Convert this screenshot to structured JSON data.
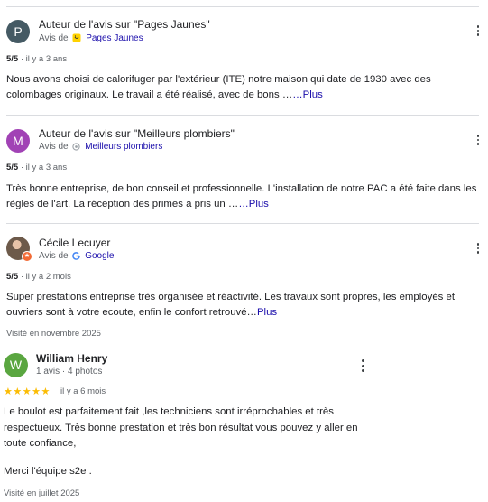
{
  "reviews": [
    {
      "avatar_letter": "P",
      "avatar_color": "#455a64",
      "author": "Auteur de l'avis sur \"Pages Jaunes\"",
      "via": "Avis de",
      "source_name": "Pages Jaunes",
      "source_icon": "pages-jaunes-icon",
      "rating": "5/5",
      "time": " · il y a 3 ans",
      "text": "Nous avons choisi de calorifuger par l'extérieur (ITE) notre maison qui date de 1930 avec des colombages originaux. Le travail a été réalisé, avec de bons …",
      "more": "…Plus"
    },
    {
      "avatar_letter": "M",
      "avatar_color": "#a142b5",
      "author": "Auteur de l'avis sur \"Meilleurs plombiers\"",
      "via": "Avis de",
      "source_name": "Meilleurs plombiers",
      "source_icon": "meilleurs-plombiers-icon",
      "rating": "5/5",
      "time": " · il y a 3 ans",
      "text": "Très bonne entreprise, de bon conseil et professionnelle. L'installation de notre PAC a été faite dans les règles de l'art. La réception des primes a pris un …",
      "more": "…Plus"
    },
    {
      "avatar_letter": "",
      "avatar_color": "#6d5a4a",
      "author": "Cécile Lecuyer",
      "via": "Avis de",
      "source_name": "Google",
      "source_icon": "google-icon",
      "rating": "5/5",
      "time": " · il y a 2 mois",
      "text": "Super prestations entreprise très organisée et réactivité. Les travaux sont propres, les employés et ouvriers sont à votre ecoute, enfin le confort retrouvé…",
      "more": "Plus",
      "visited": "Visité en novembre 2025"
    }
  ],
  "last_review": {
    "avatar_letter": "W",
    "avatar_color": "#5aa640",
    "author": "William Henry",
    "meta": "1 avis · 4 photos",
    "stars": "★★★★★",
    "rating_value": 5,
    "time": "il y a 6 mois",
    "paragraph1": "Le boulot est parfaitement fait ,les techniciens sont irréprochables et très respectueux. Très bonne prestation et très bon résultat vous pouvez y aller en toute confiance,",
    "paragraph2": "Merci l'équipe s2e .",
    "visited": "Visité en juillet 2025"
  },
  "colors": {
    "link": "#1a0dab",
    "star": "#fbbc04",
    "divider": "#dadce0"
  }
}
